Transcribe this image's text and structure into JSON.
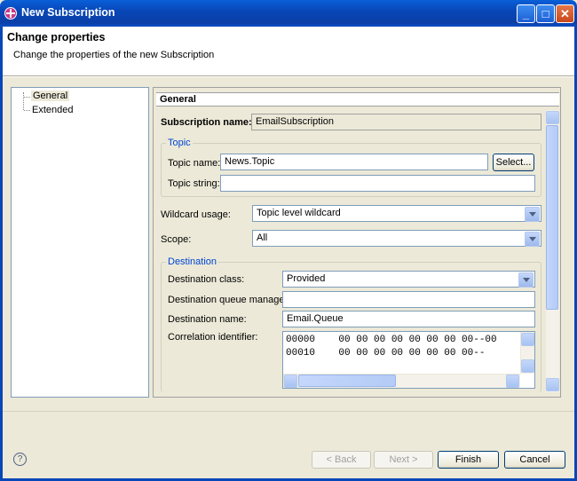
{
  "window": {
    "title": "New Subscription",
    "min": "_",
    "max": "□",
    "close": "✕"
  },
  "header": {
    "title": "Change properties",
    "subtitle": "Change the properties of the new Subscription"
  },
  "tree": {
    "items": [
      {
        "label": "General"
      },
      {
        "label": "Extended"
      }
    ]
  },
  "panel": {
    "heading": "General",
    "subscription_name_label": "Subscription name:",
    "subscription_name": "EmailSubscription",
    "topic_group": "Topic",
    "topic_name_label": "Topic name:",
    "topic_name": "News.Topic",
    "select_button": "Select...",
    "topic_string_label": "Topic string:",
    "topic_string": "",
    "wildcard_label": "Wildcard usage:",
    "wildcard_value": "Topic level wildcard",
    "scope_label": "Scope:",
    "scope_value": "All",
    "destination_group": "Destination",
    "dest_class_label": "Destination class:",
    "dest_class_value": "Provided",
    "dest_qmgr_label": "Destination queue manager:",
    "dest_qmgr_value": "",
    "dest_name_label": "Destination name:",
    "dest_name_value": "Email.Queue",
    "correl_label": "Correlation identifier:",
    "correl_lines": [
      "00000    00 00 00 00 00 00 00 00--00",
      "00010    00 00 00 00 00 00 00 00--"
    ]
  },
  "footer": {
    "help_icon": "?",
    "back": "< Back",
    "next": "Next >",
    "finish": "Finish",
    "cancel": "Cancel"
  }
}
